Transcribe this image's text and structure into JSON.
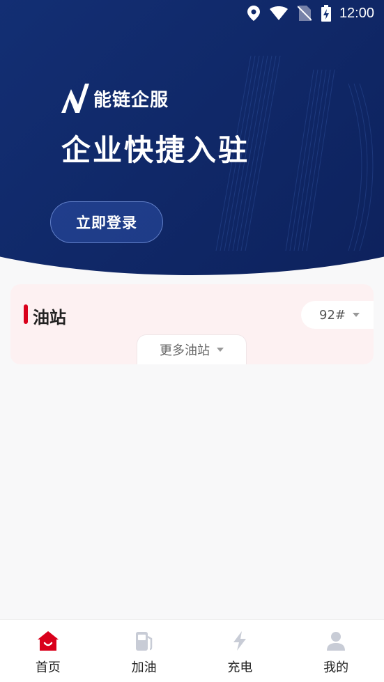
{
  "status_bar": {
    "time": "12:00",
    "icons": [
      "location-icon",
      "wifi-icon",
      "no-sim-icon",
      "battery-charging-icon"
    ]
  },
  "hero": {
    "brand_name": "能链企服",
    "title": "企业快捷入驻",
    "login_button": "立即登录"
  },
  "station_card": {
    "title": "油站",
    "fuel_type": "92#",
    "more_stations": "更多油站"
  },
  "tab_bar": {
    "active_color": "#d9001b",
    "inactive_color": "#c8ccd6",
    "tabs": [
      {
        "label": "首页",
        "icon": "home-icon",
        "active": true
      },
      {
        "label": "加油",
        "icon": "fuel-pump-icon",
        "active": false
      },
      {
        "label": "充电",
        "icon": "lightning-icon",
        "active": false
      },
      {
        "label": "我的",
        "icon": "user-icon",
        "active": false
      }
    ]
  }
}
